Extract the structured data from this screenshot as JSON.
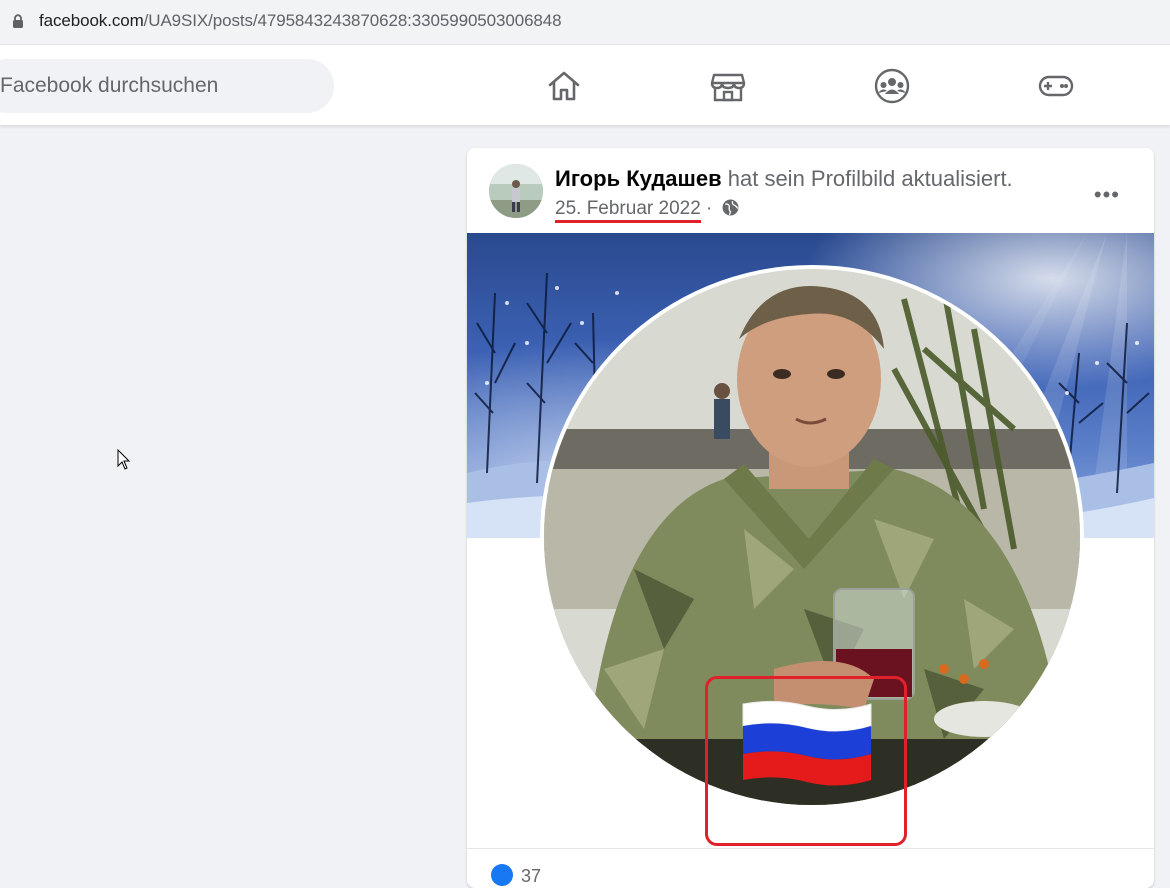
{
  "browser": {
    "url_host": "facebook.com",
    "url_path": "/UA9SIX/posts/4795843243870628:3305990503006848"
  },
  "header": {
    "search_placeholder": "Facebook durchsuchen",
    "nav": [
      {
        "icon": "home-icon"
      },
      {
        "icon": "marketplace-icon"
      },
      {
        "icon": "groups-icon"
      },
      {
        "icon": "gaming-icon"
      }
    ]
  },
  "post": {
    "author": "Игорь Кудашев",
    "action": "hat sein Profilbild aktualisiert.",
    "date": "25. Februar 2022",
    "separator": "·",
    "privacy_icon": "globe-icon",
    "more_label": "•••",
    "reaction_count": "37"
  },
  "annotation_colors": {
    "underline": "#e0202a",
    "box": "#e0202a"
  }
}
